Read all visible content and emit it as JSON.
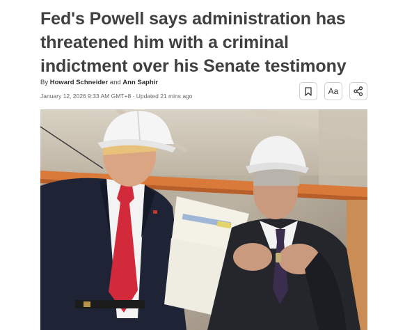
{
  "article": {
    "headline": "Fed's Powell says administration has threatened him with a criminal indictment over his Senate testimony",
    "byline": {
      "prefix": "By ",
      "author1": "Howard Schneider",
      "conjunction": " and ",
      "author2": "Ann Saphir"
    },
    "dateline": "January 12, 2026 9:33 AM GMT+8 · Updated 21 mins ago"
  },
  "actions": {
    "save_icon": "bookmark-icon",
    "text_size_label": "Aa",
    "share_icon": "share-icon"
  },
  "photo": {
    "description_icon": "news-photo"
  }
}
